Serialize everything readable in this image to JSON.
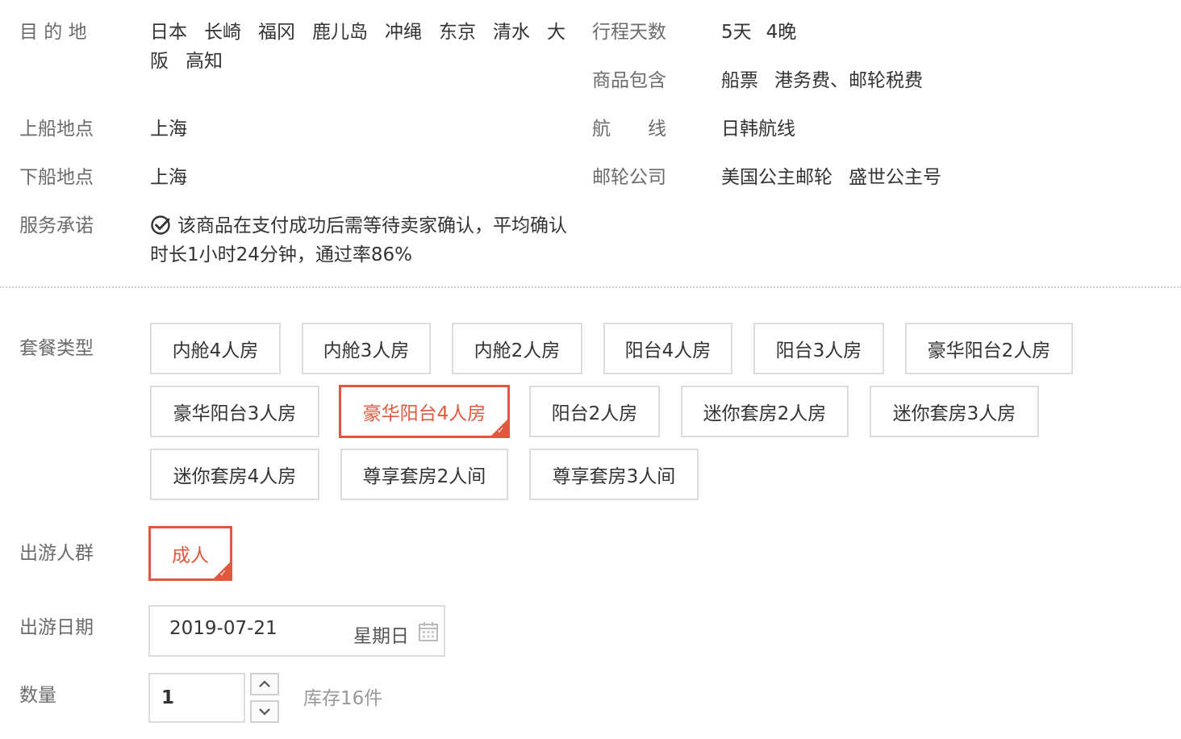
{
  "info": {
    "destination_label": "目 的 地",
    "destinations_line1": [
      "日本",
      "长崎",
      "福冈",
      "鹿儿岛",
      "冲绳",
      "东京",
      "清水",
      "大"
    ],
    "destinations_line2": [
      "阪",
      "高知"
    ],
    "days_label": "行程天数",
    "days_value": [
      "5天",
      "4晚"
    ],
    "includes_label": "商品包含",
    "includes_value": [
      "船票",
      "港务费、邮轮税费"
    ],
    "board_label": "上船地点",
    "board_value": "上海",
    "route_label": "航　　线",
    "route_value": "日韩航线",
    "alight_label": "下船地点",
    "alight_value": "上海",
    "company_label": "邮轮公司",
    "company_value": [
      "美国公主邮轮",
      "盛世公主号"
    ],
    "promise_label": "服务承诺",
    "promise_text": "该商品在支付成功后需等待卖家确认，平均确认时长1小时24分钟，通过率86%"
  },
  "package": {
    "label": "套餐类型",
    "options": [
      "内舱4人房",
      "内舱3人房",
      "内舱2人房",
      "阳台4人房",
      "阳台3人房",
      "豪华阳台2人房",
      "豪华阳台3人房",
      "豪华阳台4人房",
      "阳台2人房",
      "迷你套房2人房",
      "迷你套房3人房",
      "迷你套房4人房",
      "尊享套房2人间",
      "尊享套房3人间"
    ],
    "selected": "豪华阳台4人房"
  },
  "group": {
    "label": "出游人群",
    "options": [
      "成人"
    ],
    "selected": "成人"
  },
  "date": {
    "label": "出游日期",
    "value": "2019-07-21",
    "weekday": "星期日"
  },
  "quantity": {
    "label": "数量",
    "value": "1",
    "stock": "库存16件"
  },
  "colors": {
    "accent": "#e2583e",
    "label": "#6b6b6b",
    "border": "#dcdcdc"
  }
}
